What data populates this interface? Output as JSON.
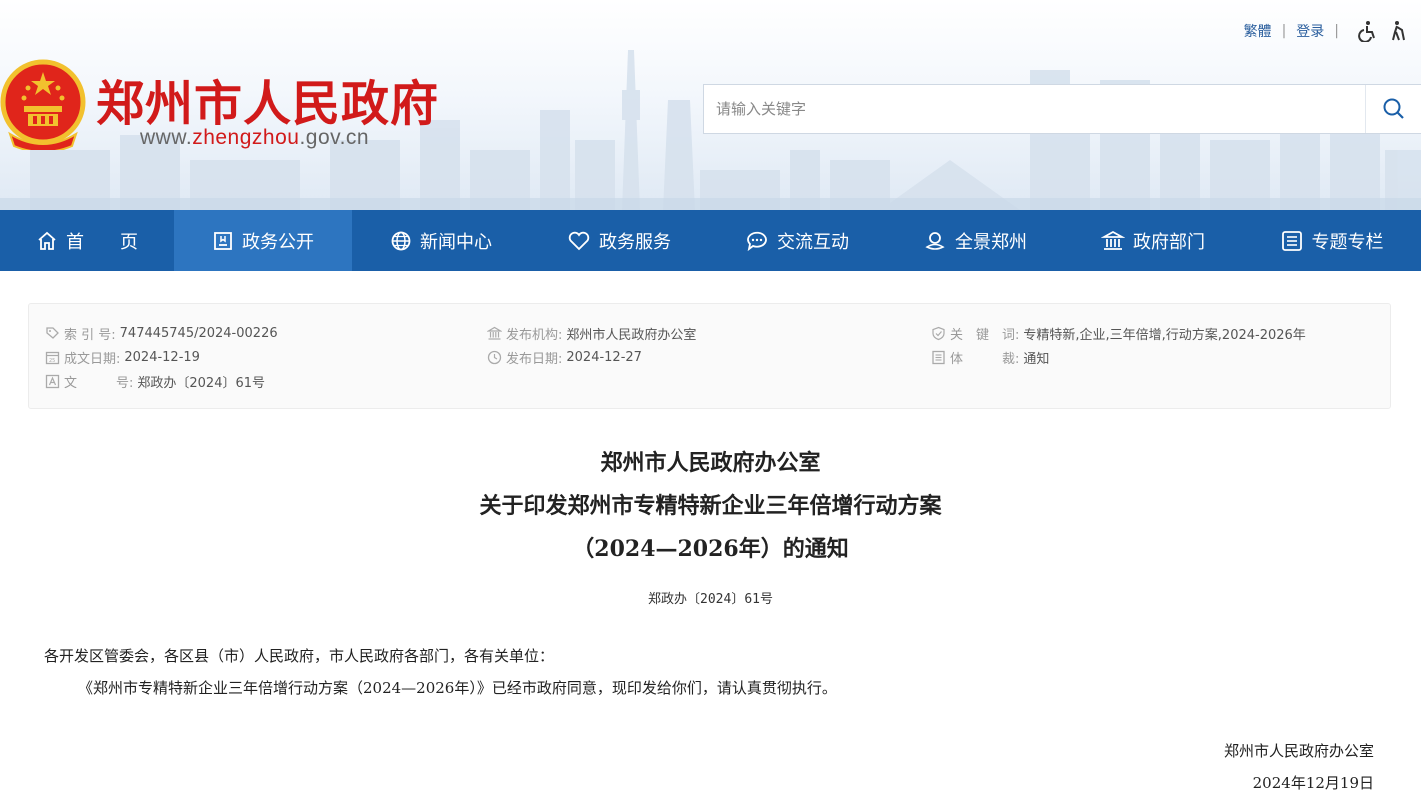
{
  "header": {
    "site_title": "郑州市人民政府",
    "site_url_prefix": "www.",
    "site_url_highlight": "zhengzhou",
    "site_url_suffix": ".gov.cn",
    "top_links": {
      "traditional": "繁體",
      "login": "登录"
    },
    "search_placeholder": "请输入关键字",
    "brand_color": "#d11a1a"
  },
  "nav": {
    "items": [
      {
        "label": "首　　页",
        "icon": "home-icon"
      },
      {
        "label": "政务公开",
        "icon": "document-icon"
      },
      {
        "label": "新闻中心",
        "icon": "globe-icon"
      },
      {
        "label": "政务服务",
        "icon": "heart-icon"
      },
      {
        "label": "交流互动",
        "icon": "chat-icon"
      },
      {
        "label": "全景郑州",
        "icon": "panorama-icon"
      },
      {
        "label": "政府部门",
        "icon": "building-icon"
      },
      {
        "label": "专题专栏",
        "icon": "list-icon"
      }
    ],
    "active_index": 1,
    "color": "#1a5fa8"
  },
  "meta": {
    "index_label": "索 引 号:",
    "index_value": "747445745/2024-00226",
    "publisher_label": "发布机构:",
    "publisher_value": "郑州市人民政府办公室",
    "keywords_label": "关　键　词:",
    "keywords_value": "专精特新,企业,三年倍增,行动方案,2024-2026年",
    "created_label": "成文日期:",
    "created_value": "2024-12-19",
    "published_label": "发布日期:",
    "published_value": "2024-12-27",
    "genre_label": "体　　　裁:",
    "genre_value": "通知",
    "docno_label": "文　　　号:",
    "docno_value": "郑政办〔2024〕61号"
  },
  "document": {
    "title_line1": "郑州市人民政府办公室",
    "title_line2": "关于印发郑州市专精特新企业三年倍增行动方案",
    "title_line3": "（2024—2026年）的通知",
    "doc_number": "郑政办〔2024〕61号",
    "salutation": "各开发区管委会，各区县（市）人民政府，市人民政府各部门，各有关单位：",
    "body": "《郑州市专精特新企业三年倍增行动方案（2024—2026年）》已经市政府同意，现印发给你们，请认真贯彻执行。",
    "signer": "郑州市人民政府办公室",
    "date": "2024年12月19日"
  }
}
